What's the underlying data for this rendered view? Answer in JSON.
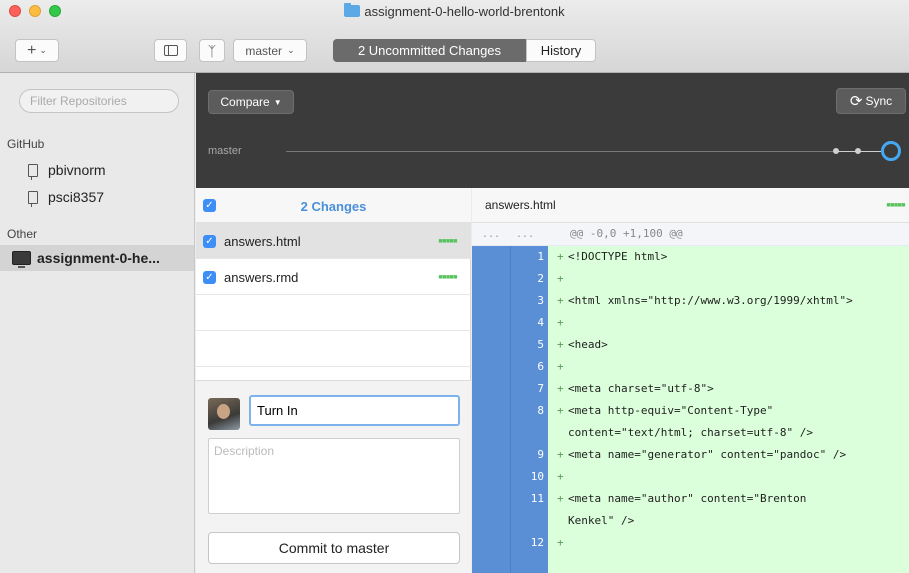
{
  "window": {
    "title": "assignment-0-hello-world-brentonk"
  },
  "toolbar": {
    "add_label": "+",
    "branch_label": "master",
    "tabs": [
      {
        "label": "2 Uncommitted Changes",
        "active": true
      },
      {
        "label": "History",
        "active": false
      }
    ]
  },
  "sidebar": {
    "filter_placeholder": "Filter Repositories",
    "sections": [
      {
        "title": "GitHub",
        "items": [
          "pbivnorm",
          "psci8357"
        ]
      },
      {
        "title": "Other",
        "items": [
          "assignment-0-he..."
        ]
      }
    ]
  },
  "top_panel": {
    "compare_label": "Compare",
    "sync_label": "Sync",
    "branch": "master"
  },
  "changes": {
    "title": "2 Changes",
    "files": [
      {
        "name": "answers.html",
        "checked": true,
        "selected": true
      },
      {
        "name": "answers.rmd",
        "checked": true,
        "selected": false
      }
    ]
  },
  "commit": {
    "summary_value": "Turn In",
    "description_placeholder": "Description",
    "button_label": "Commit to master"
  },
  "diff": {
    "filename": "answers.html",
    "hunk_gutter": "...",
    "hunk_header": "@@ -0,0 +1,100 @@",
    "lines": [
      {
        "num": "1",
        "prefix": "+",
        "text": "<!DOCTYPE html>"
      },
      {
        "num": "2",
        "prefix": "+",
        "text": ""
      },
      {
        "num": "3",
        "prefix": "+",
        "text": "<html xmlns=\"http://www.w3.org/1999/xhtml\">"
      },
      {
        "num": "4",
        "prefix": "+",
        "text": ""
      },
      {
        "num": "5",
        "prefix": "+",
        "text": "<head>"
      },
      {
        "num": "6",
        "prefix": "+",
        "text": ""
      },
      {
        "num": "7",
        "prefix": "+",
        "text": "<meta charset=\"utf-8\">"
      },
      {
        "num": "8",
        "prefix": "+",
        "text": "<meta http-equiv=\"Content-Type\""
      },
      {
        "num": "",
        "prefix": "",
        "text": "content=\"text/html; charset=utf-8\" />"
      },
      {
        "num": "9",
        "prefix": "+",
        "text": "<meta name=\"generator\" content=\"pandoc\" />"
      },
      {
        "num": "10",
        "prefix": "+",
        "text": ""
      },
      {
        "num": "11",
        "prefix": "+",
        "text": "<meta name=\"author\" content=\"Brenton"
      },
      {
        "num": "",
        "prefix": "",
        "text": "Kenkel\" />"
      },
      {
        "num": "12",
        "prefix": "+",
        "text": ""
      }
    ]
  },
  "colors": {
    "accent": "#3e8ef7",
    "added_bg": "#dbffdb",
    "gutter": "#5a8fd6",
    "dark_panel": "#3b3b3b"
  },
  "icons": {
    "add": "plus-icon",
    "sidebar_toggle": "sidebar-toggle-icon",
    "branch": "branch-icon",
    "repo": "repo-icon",
    "local_repo": "monitor-icon",
    "sync": "sync-icon",
    "folder": "folder-icon"
  }
}
